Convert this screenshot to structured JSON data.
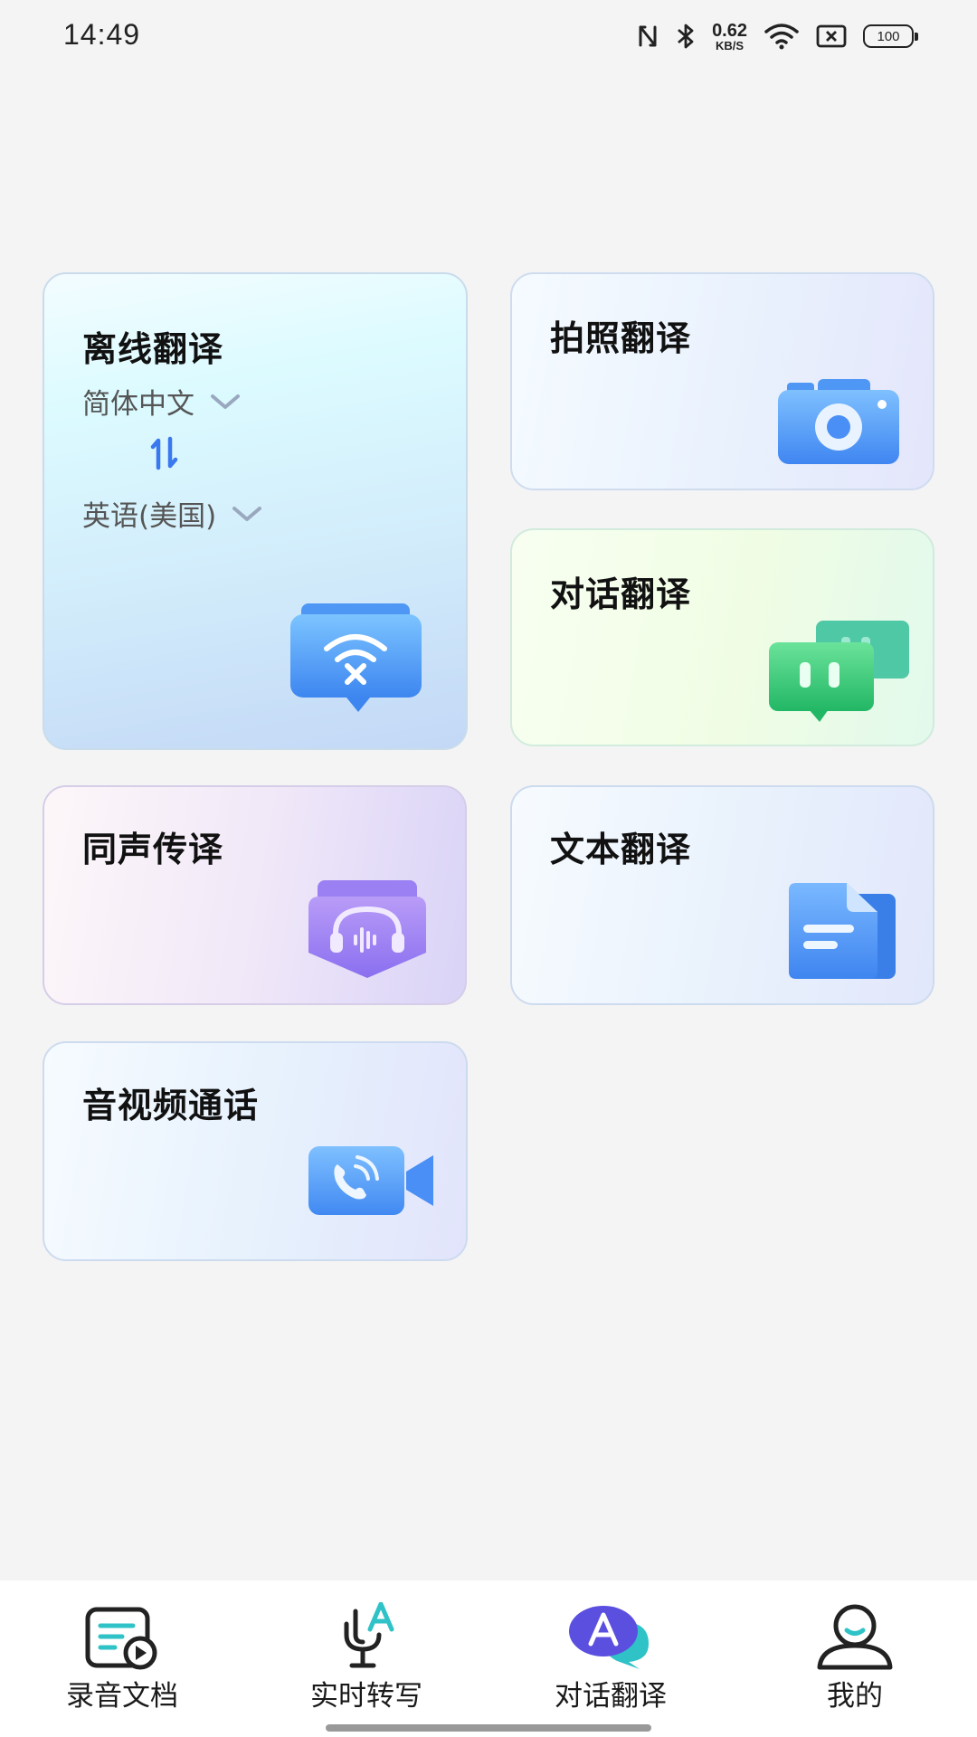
{
  "status_bar": {
    "time": "14:49",
    "net_speed_value": "0.62",
    "net_speed_unit": "KB/S",
    "battery": "100",
    "icons": [
      "nfc-icon",
      "bluetooth-icon",
      "wifi-icon",
      "sim-off-icon"
    ]
  },
  "cards": {
    "offline": {
      "title": "离线翻译",
      "source_lang": "简体中文",
      "target_lang": "英语(美国)",
      "icon": "wifi-off-chat-icon"
    },
    "photo": {
      "title": "拍照翻译",
      "icon": "camera-icon"
    },
    "dialog": {
      "title": "对话翻译",
      "icon": "chat-bubbles-icon"
    },
    "simul": {
      "title": "同声传译",
      "icon": "headset-icon"
    },
    "text": {
      "title": "文本翻译",
      "icon": "document-icon"
    },
    "call": {
      "title": "音视频通话",
      "icon": "video-call-icon"
    }
  },
  "nav": {
    "active_index": 2,
    "items": [
      {
        "label": "录音文档",
        "icon": "recording-doc-icon"
      },
      {
        "label": "实时转写",
        "icon": "mic-transcribe-icon"
      },
      {
        "label": "对话翻译",
        "icon": "dialog-translate-icon"
      },
      {
        "label": "我的",
        "icon": "profile-icon"
      }
    ]
  },
  "colors": {
    "background": "#f4f4f4",
    "accent_blue": "#4a8ff5",
    "nav_active": "#5b4fe0"
  }
}
